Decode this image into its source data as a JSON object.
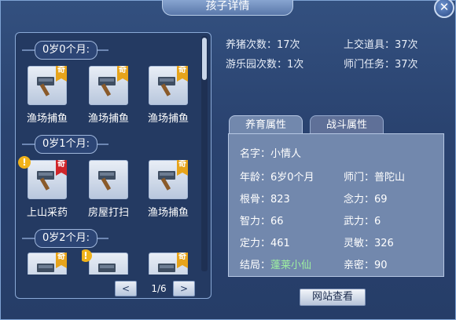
{
  "title": "孩子详情",
  "close_glyph": "✕",
  "sections": [
    {
      "label": "0岁0个月:",
      "items": [
        {
          "name": "渔场捕鱼",
          "badge": "奇",
          "badge_color": "#e7a41b",
          "alert": false
        },
        {
          "name": "渔场捕鱼",
          "badge": "奇",
          "badge_color": "#e7a41b",
          "alert": false
        },
        {
          "name": "渔场捕鱼",
          "badge": "奇",
          "badge_color": "#e7a41b",
          "alert": false
        }
      ]
    },
    {
      "label": "0岁1个月:",
      "items": [
        {
          "name": "上山采药",
          "badge": "奇",
          "badge_color": "#d0262a",
          "alert": true
        },
        {
          "name": "房屋打扫",
          "badge": "",
          "badge_color": "",
          "alert": false
        },
        {
          "name": "渔场捕鱼",
          "badge": "奇",
          "badge_color": "#e7a41b",
          "alert": false
        }
      ]
    },
    {
      "label": "0岁2个月:",
      "items": [
        {
          "name": "",
          "badge": "奇",
          "badge_color": "#e7a41b",
          "alert": false
        },
        {
          "name": "",
          "badge": "",
          "badge_color": "",
          "alert": true
        },
        {
          "name": "",
          "badge": "奇",
          "badge_color": "#e7a41b",
          "alert": false
        }
      ]
    }
  ],
  "alert_glyph": "!",
  "pager": {
    "prev": "<",
    "next": ">",
    "page": "1/6"
  },
  "stats": {
    "pig": "养猪次数：17次",
    "items_turned": "上交道具：37次",
    "playground": "游乐园次数：1次",
    "sect_task": "师门任务：37次"
  },
  "tabs": {
    "active": "养育属性",
    "inactive": "战斗属性"
  },
  "attributes": {
    "name_label": "名字：",
    "name": "小情人",
    "age_label": "年龄：",
    "age": "6岁0个月",
    "sect_label": "师门：",
    "sect": "普陀山",
    "root_label": "根骨：",
    "root": "823",
    "mind_label": "念力：",
    "mind": "69",
    "int_label": "智力：",
    "int": "66",
    "force_label": "武力：",
    "force": "6",
    "focus_label": "定力：",
    "focus": "461",
    "agility_label": "灵敏：",
    "agility": "326",
    "ending_label": "结局：",
    "ending": "蓬莱小仙",
    "intimacy_label": "亲密：",
    "intimacy": "90"
  },
  "site_button": "网站查看",
  "colors": {
    "accent_green": "#9ef0a0",
    "badge_gold": "#e7a41b",
    "badge_red": "#d0262a"
  }
}
